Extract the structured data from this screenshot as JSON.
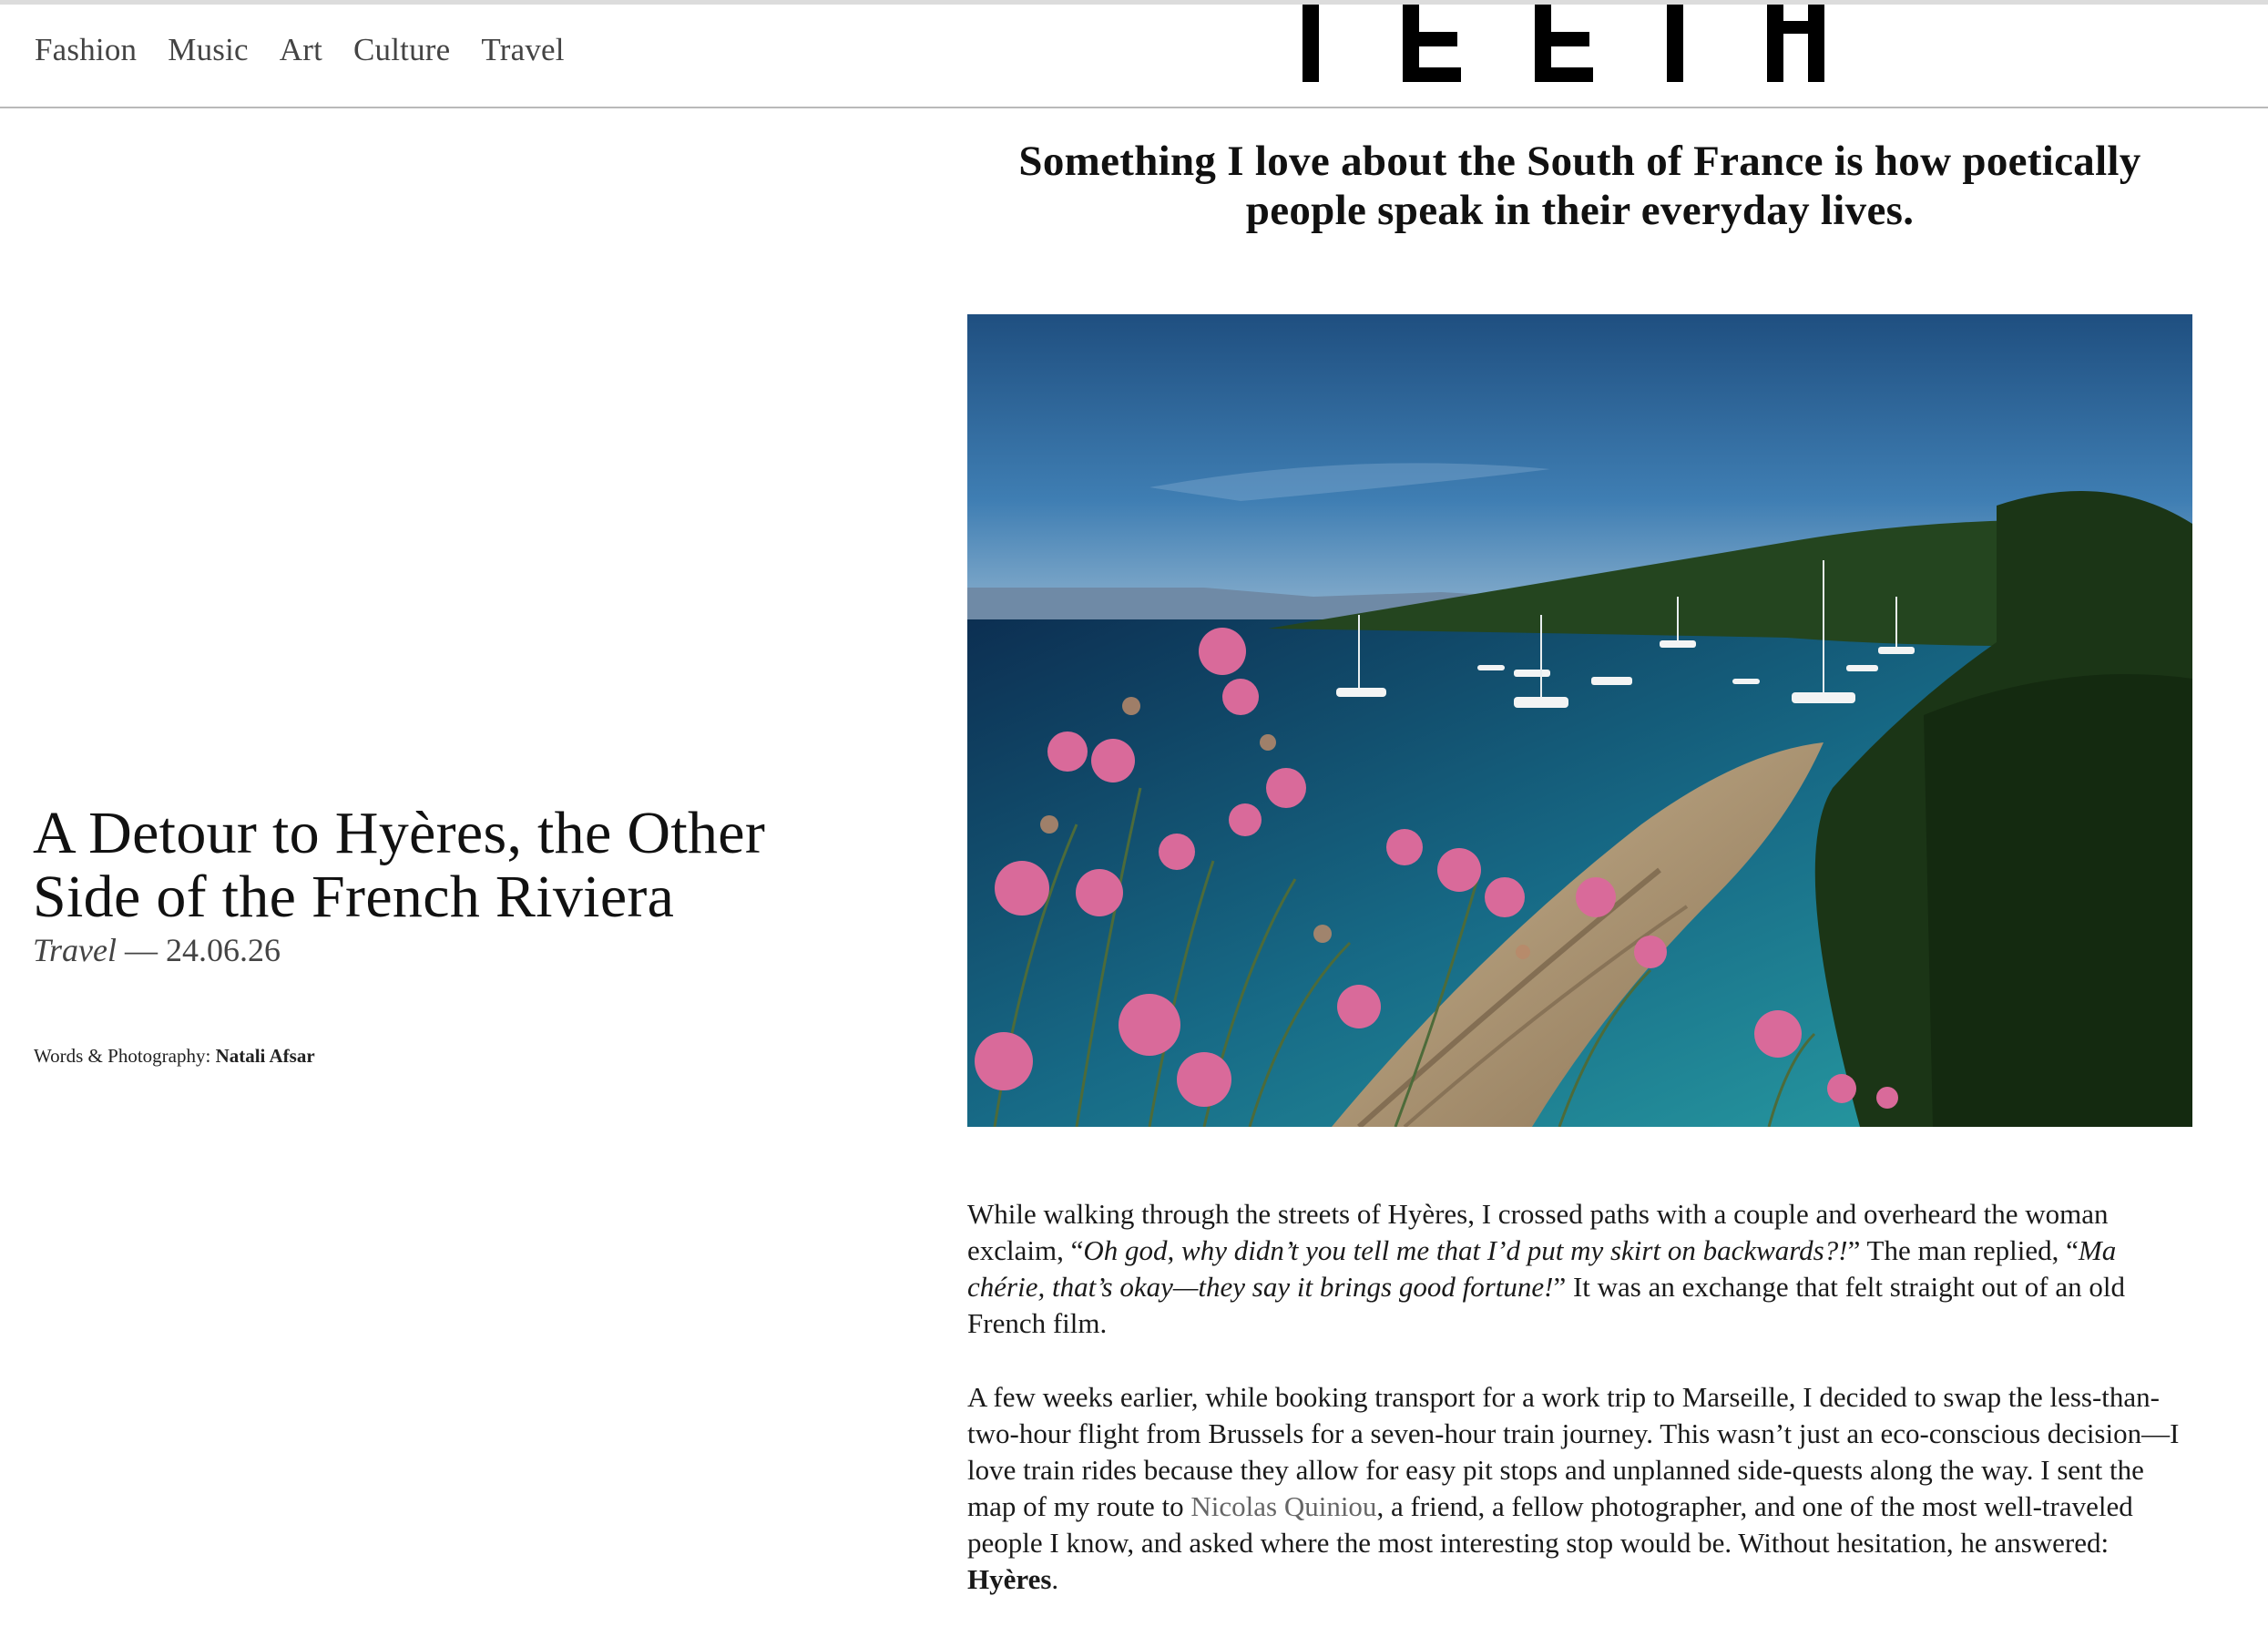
{
  "header": {
    "nav": [
      "Fashion",
      "Music",
      "Art",
      "Culture",
      "Travel"
    ],
    "logo_text": "TEETH"
  },
  "article": {
    "title": "A Detour to Hyères, the Other Side of the French Riviera",
    "category": "Travel",
    "date_separator": " — ",
    "date": "24.06.26",
    "credits_label": "Words & Photography: ",
    "credits_name": "Natali Afsar",
    "pullquote": "Something I love about the South of France is how poetically people speak in their everyday lives.",
    "photo_alt": "Coastal cove with turquoise water, anchored sailboats, rocky shore and pink thistle flowers",
    "p1": {
      "t1": "While walking through the streets of Hyères, I crossed paths with a couple and overheard the woman exclaim, “",
      "q1": "Oh god, why didn’t you tell me that I’d put my skirt on backwards?!",
      "t2": "” The man replied, “",
      "q2": "Ma chérie, that’s okay—they say it brings good fortune!",
      "t3": "” It was an exchange that felt straight out of an old French film."
    },
    "p2": {
      "t1": "A few weeks earlier, while booking transport for a work trip to Marseille, I decided to swap the less-than-two-hour flight from Brussels for a seven-hour train journey. This wasn’t just an eco-conscious decision—I love train rides because they allow for easy pit stops and unplanned side-quests along the way. I sent the map of my route to ",
      "link": "Nicolas Quiniou",
      "t2": ", a friend, a fellow photographer, and one of the most well-traveled people I know, and asked where the most interesting stop would be. Without hesitation, he answered: ",
      "bold": "Hyères",
      "t3": "."
    }
  },
  "colors": {
    "text": "#111111",
    "nav_text": "#444444",
    "link": "#666666",
    "rule": "#b9b9b9",
    "sea": "#2aa3a6",
    "sky": "#3f7eb3"
  }
}
